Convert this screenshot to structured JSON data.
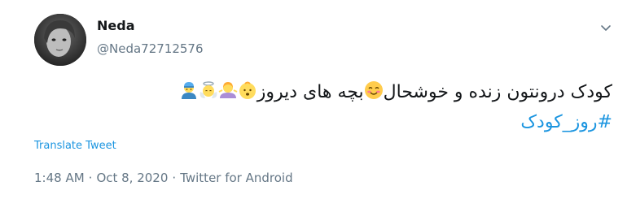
{
  "tweet": {
    "author_name": "Neda",
    "author_handle": "@Neda72712576",
    "text_line1": "کودک درونتون زنده و خوشحال",
    "text_line1b": "بچه های دیروز",
    "hashtag": "#روز_کودک",
    "translate_label": "Translate Tweet",
    "time": "1:48 AM",
    "date": "Oct 8, 2020",
    "source": "Twitter for Android",
    "separator": "·"
  },
  "colors": {
    "link": "#1b95e0",
    "secondary": "#657786",
    "primary": "#14171a"
  },
  "icons": {
    "menu": "chevron-down-icon",
    "emoji_smile": "smiling-face-icon",
    "emoji_baby": "baby-icon",
    "emoji_shrug": "person-shrugging-icon",
    "emoji_angel": "baby-angel-icon",
    "emoji_mechanic": "man-mechanic-icon"
  }
}
